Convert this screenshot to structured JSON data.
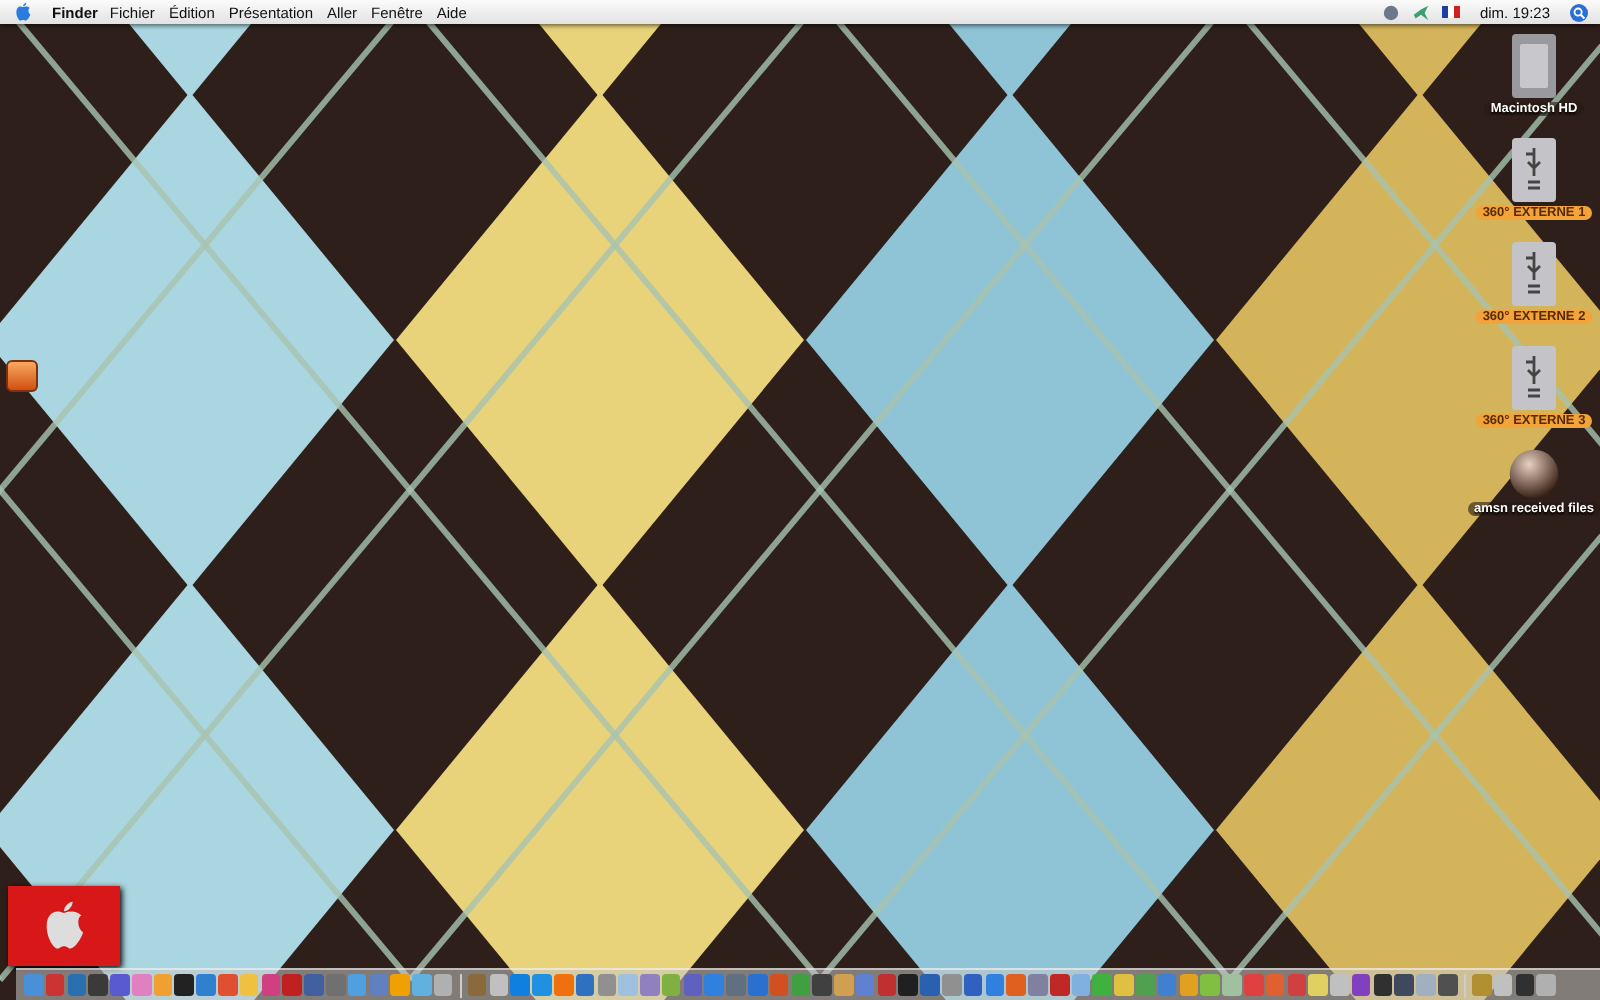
{
  "menu_bar": {
    "app_name": "Finder",
    "menus": [
      "Fichier",
      "Édition",
      "Présentation",
      "Aller",
      "Fenêtre",
      "Aide"
    ],
    "clock": "dim. 19:23"
  },
  "desktop_icons": [
    {
      "label": "Macintosh HD",
      "kind": "hard-disk"
    },
    {
      "label": "360° EXTERNE 1",
      "kind": "firewire-drive",
      "color": "#f2a33a"
    },
    {
      "label": "360° EXTERNE 2",
      "kind": "firewire-drive",
      "color": "#f2a33a"
    },
    {
      "label": "360° EXTERNE 3",
      "kind": "firewire-drive",
      "color": "#f2a33a"
    },
    {
      "label": "amsn received files",
      "kind": "sphere-folder"
    }
  ]
}
